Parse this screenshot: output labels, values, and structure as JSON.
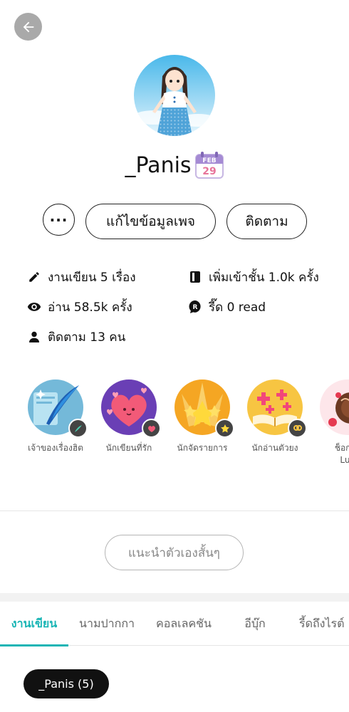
{
  "profile": {
    "name": "_Panis",
    "calendar_month": "FEB",
    "calendar_day": "29"
  },
  "actions": {
    "more_label": "···",
    "edit_label": "แก้ไขข้อมูลเพจ",
    "follow_label": "ติดตาม"
  },
  "stats": {
    "works": "งานเขียน 5 เรื่อง",
    "shelf": "เพิ่มเข้าชั้น 1.0k ครั้ง",
    "reads": "อ่าน 58.5k ครั้ง",
    "reeds": "รี๊ด 0 read",
    "following": "ติดตาม 13 คน"
  },
  "badges": [
    {
      "label": "เจ้าของเรื่องฮิต",
      "icon": "feather-icon"
    },
    {
      "label": "นักเขียนที่รัก",
      "icon": "heart-icon"
    },
    {
      "label": "นักจัดรายการ",
      "icon": "star-icon"
    },
    {
      "label": "นักอ่านตัวยง",
      "icon": "book-icon"
    },
    {
      "label": "ช็อกโก Luv",
      "label_line1": "ช็อกโก",
      "label_line2": "Luv",
      "icon": "chocolate-icon"
    }
  ],
  "intro_label": "แนะนำตัวเองสั้นๆ",
  "tabs": [
    {
      "label": "งานเขียน",
      "active": true
    },
    {
      "label": "นามปากกา",
      "active": false
    },
    {
      "label": "คอลเลคชัน",
      "active": false
    },
    {
      "label": "อีบุ๊ก",
      "active": false
    },
    {
      "label": "รี้ดถึงไรต์",
      "active": false
    }
  ],
  "chip_label": "_Panis (5)",
  "colors": {
    "accent": "#1ab5b5",
    "back_button": "#a9a9a9"
  }
}
